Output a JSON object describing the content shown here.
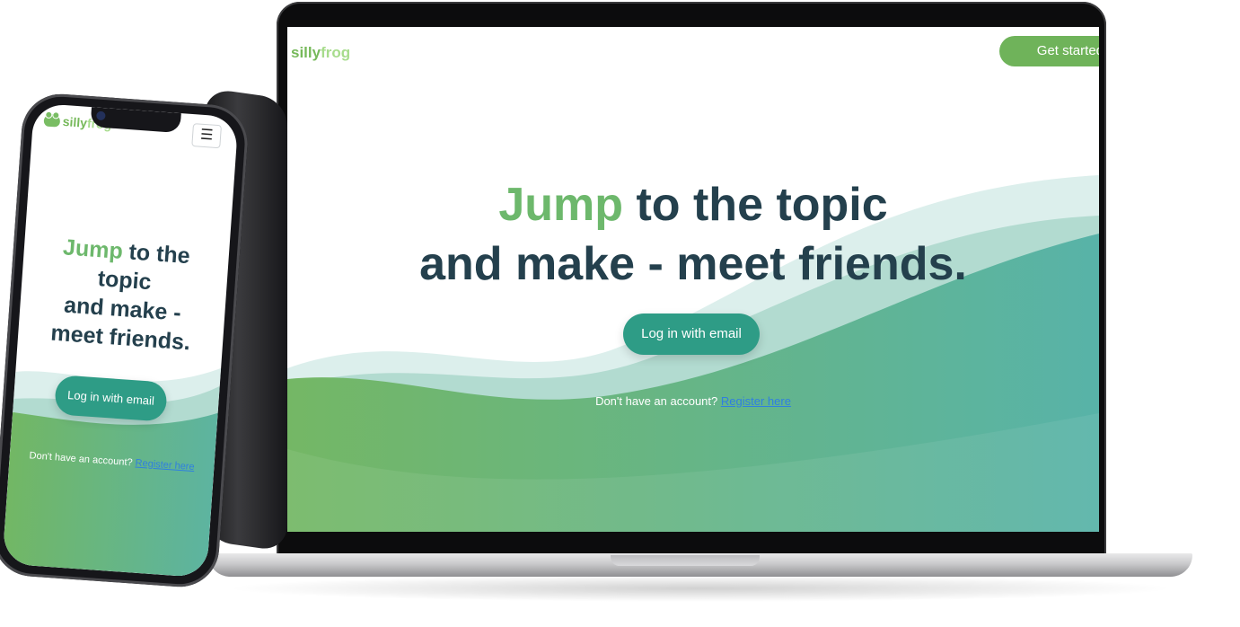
{
  "brand": {
    "logo_part1": "silly",
    "logo_part2": "frog"
  },
  "desktop": {
    "cta_label": "Get started",
    "hero_highlight": "Jump",
    "hero_line1_rest": " to the topic",
    "hero_line2": "and make - meet friends.",
    "login_label": "Log in with email",
    "signup_prompt": "Don't have an account?",
    "signup_link": "Register here"
  },
  "mobile": {
    "menu_icon": "hamburger-icon",
    "hero_highlight": "Jump",
    "hero_line1_rest": " to the",
    "hero_line2": "topic",
    "hero_line3": "and make -",
    "hero_line4": "meet friends.",
    "login_label": "Log in with email",
    "signup_prompt": "Don't have an account?",
    "signup_link": "Register here"
  },
  "colors": {
    "brand_green": "#76b95a",
    "brand_light_green": "#a7dc8c",
    "heading_dark": "#24404d",
    "button_teal": "#2e9c86",
    "link_blue": "#2f7fe0"
  }
}
